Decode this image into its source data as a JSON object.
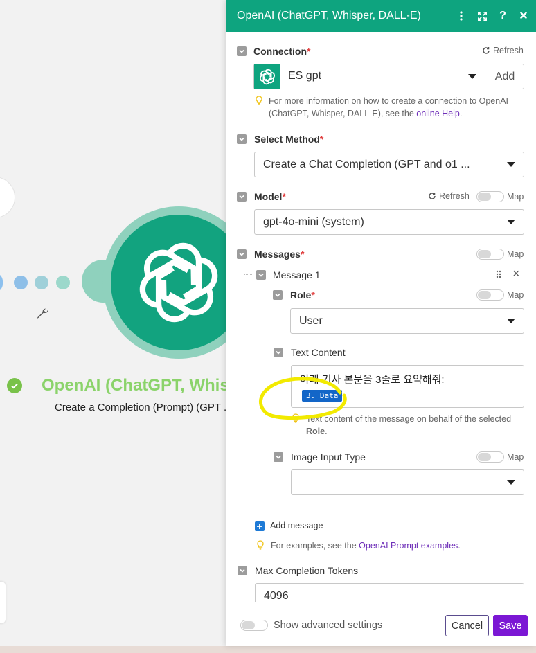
{
  "canvas": {
    "node_title": "OpenAI (ChatGPT, Whisp",
    "node_subtitle": "Create a Completion (Prompt) (GPT ."
  },
  "panel": {
    "title": "OpenAI (ChatGPT, Whisper, DALL-E)",
    "header_icons": [
      "more-vertical-icon",
      "expand-icon",
      "help-icon",
      "close-icon"
    ],
    "help_glyph": "?",
    "close_glyph": "×"
  },
  "connection": {
    "label": "Connection",
    "required_mark": "*",
    "refresh_label": "Refresh",
    "value": "ES gpt",
    "add_label": "Add",
    "hint_text": "For more information on how to create a connection to OpenAI (ChatGPT, Whisper, DALL-E), see the ",
    "hint_link": "online Help",
    "hint_end": "."
  },
  "method": {
    "label": "Select Method",
    "required_mark": "*",
    "value": "Create a Chat Completion (GPT and o1 ..."
  },
  "model": {
    "label": "Model",
    "required_mark": "*",
    "refresh_label": "Refresh",
    "map_label": "Map",
    "value": "gpt-4o-mini (system)"
  },
  "messages": {
    "label": "Messages",
    "required_mark": "*",
    "map_label": "Map",
    "item_label": "Message 1",
    "remove_glyph": "×",
    "role": {
      "label": "Role",
      "required_mark": "*",
      "map_label": "Map",
      "value": "User"
    },
    "text_content": {
      "label": "Text Content",
      "value": "아래 기사 본문을 3줄로 요약해줘:",
      "pill": "3. Data",
      "hint_text": "Text content of the message on behalf of the selected ",
      "hint_bold": "Role",
      "hint_end": "."
    },
    "image_input": {
      "label": "Image Input Type",
      "map_label": "Map",
      "value": ""
    },
    "add_message_label": "Add message",
    "examples_text": "For examples, see the ",
    "examples_link": "OpenAI Prompt examples",
    "examples_end": "."
  },
  "max_tokens": {
    "label": "Max Completion Tokens",
    "value": "4096"
  },
  "footer": {
    "advanced_label": "Show advanced settings",
    "cancel_label": "Cancel",
    "save_label": "Save"
  },
  "colors": {
    "header_green": "#0ea47f",
    "node_green": "#12a37f",
    "save_purple": "#7b17d4",
    "link_purple": "#6d2db8",
    "highlight_yellow": "#f2ea00"
  }
}
